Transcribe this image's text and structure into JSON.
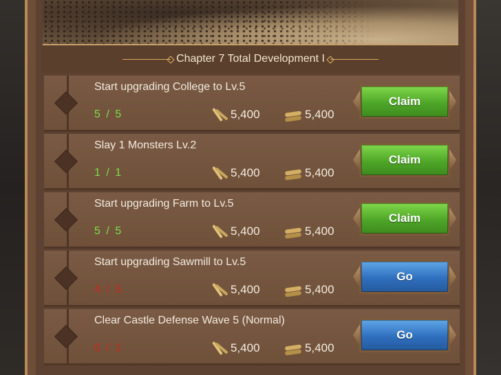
{
  "header": {
    "title": "Chapter 7 Total Development I"
  },
  "tasks": [
    {
      "name": "Start upgrading  College  to Lv.5",
      "progress": "5 / 5",
      "status": "done",
      "reward_food": "5,400",
      "reward_wood": "5,400",
      "button": "Claim",
      "button_color": "#4ea628"
    },
    {
      "name": "Slay 1 Monsters Lv.2",
      "progress": "1 / 1",
      "status": "done",
      "reward_food": "5,400",
      "reward_wood": "5,400",
      "button": "Claim",
      "button_color": "#4ea628"
    },
    {
      "name": "Start upgrading  Farm  to Lv.5",
      "progress": "5 / 5",
      "status": "done",
      "reward_food": "5,400",
      "reward_wood": "5,400",
      "button": "Claim",
      "button_color": "#4ea628"
    },
    {
      "name": "Start upgrading  Sawmill  to Lv.5",
      "progress": "4 / 5",
      "status": "pending",
      "reward_food": "5,400",
      "reward_wood": "5,400",
      "button": "Go",
      "button_color": "#2f6fbe"
    },
    {
      "name": "Clear Castle Defense Wave 5 (Normal)",
      "progress": "0 / 1",
      "status": "pending",
      "reward_food": "5,400",
      "reward_wood": "5,400",
      "button": "Go",
      "button_color": "#2f6fbe"
    }
  ],
  "icons": {
    "food": "wheat-icon",
    "wood": "wood-icon"
  },
  "colors": {
    "done_text": "#7be04a",
    "pending_text": "#c92a1e"
  }
}
